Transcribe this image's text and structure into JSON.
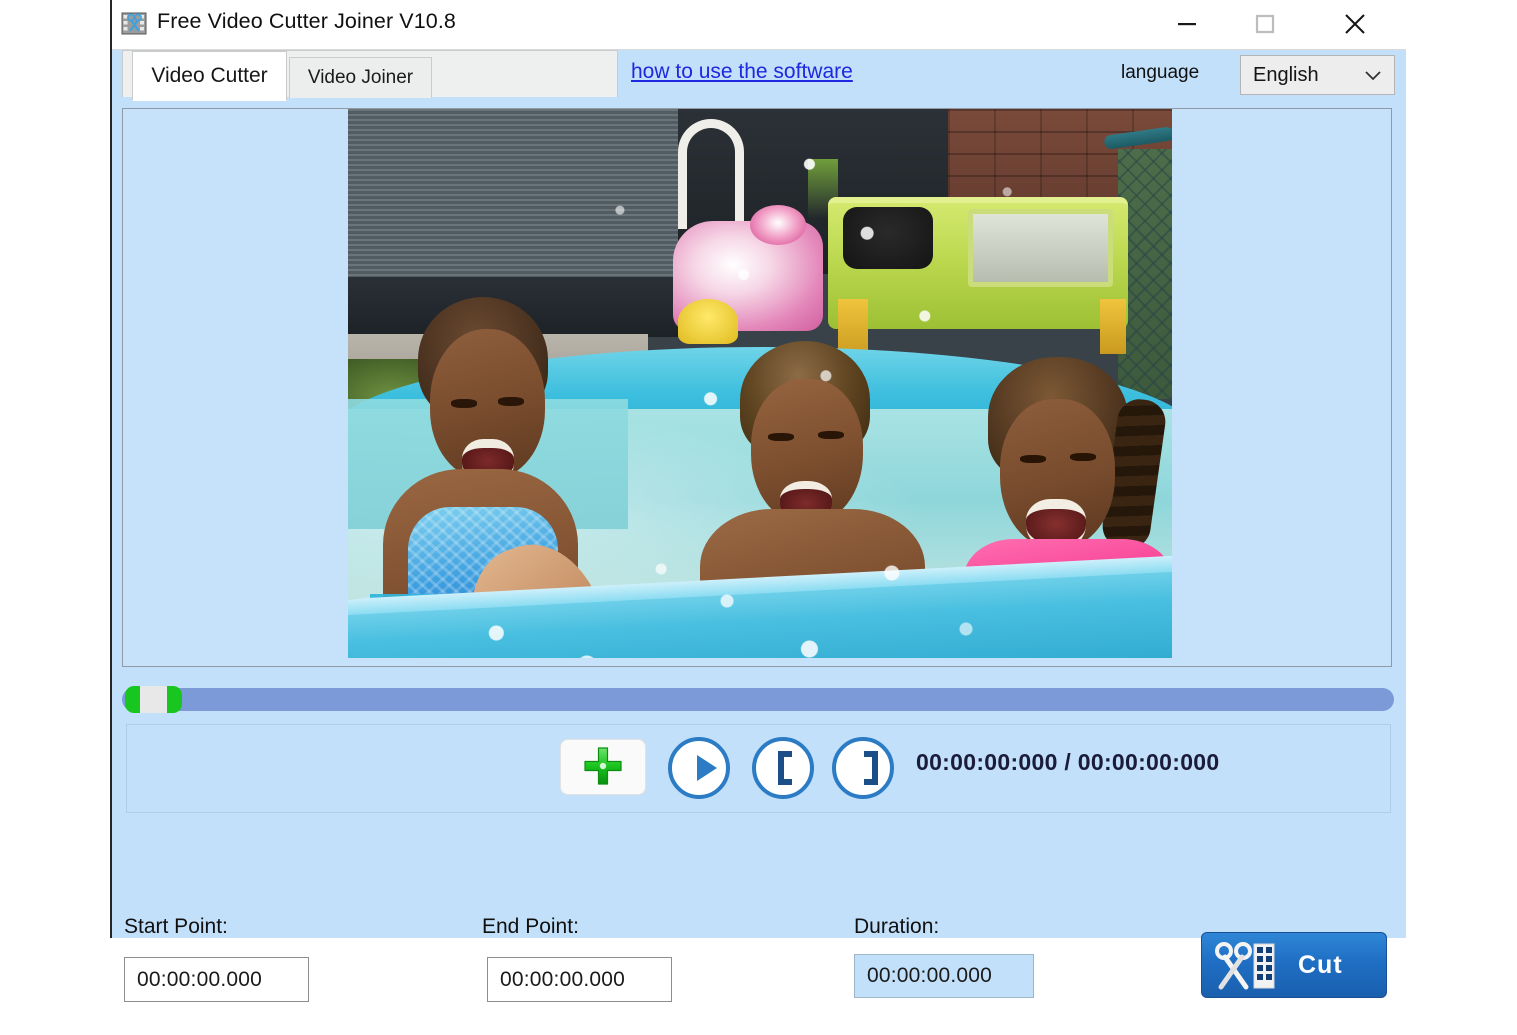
{
  "window": {
    "title": "Free Video Cutter Joiner V10.8",
    "app_icon": "scissors-film-icon",
    "controls": {
      "minimize": "minimize-icon",
      "maximize": "maximize-icon",
      "close": "close-icon"
    }
  },
  "tabs": [
    {
      "label": "Video Cutter",
      "active": true
    },
    {
      "label": "Video Joiner",
      "active": false
    }
  ],
  "header": {
    "help_link": "how to use the software",
    "language_label": "language",
    "language_value": "English",
    "language_options": [
      "English"
    ]
  },
  "preview": {
    "description": "three children playing in an inflatable paddling pool",
    "seek_position_percent": 0
  },
  "controls": {
    "add_file": "add-file-icon",
    "play": "play-icon",
    "set_start": "set-start-bracket-icon",
    "set_end": "set-end-bracket-icon",
    "time_display": "00:00:00:000 / 00:00:00:000",
    "current_time": "00:00:00:000",
    "total_time": "00:00:00:000"
  },
  "fields": {
    "start_label": "Start Point:",
    "start_value": "00:00:00.000",
    "end_label": "End Point:",
    "end_value": "00:00:00.000",
    "duration_label": "Duration:",
    "duration_value": "00:00:00.000"
  },
  "actions": {
    "cut_label": "Cut",
    "cut_icon": "scissors-film-icon"
  },
  "colors": {
    "panel_blue": "#c2e0f9",
    "accent_blue": "#1f6fc4",
    "link_blue": "#1d28e0",
    "seek_track": "#7c9ad8",
    "seek_thumb_green": "#19c61f"
  }
}
